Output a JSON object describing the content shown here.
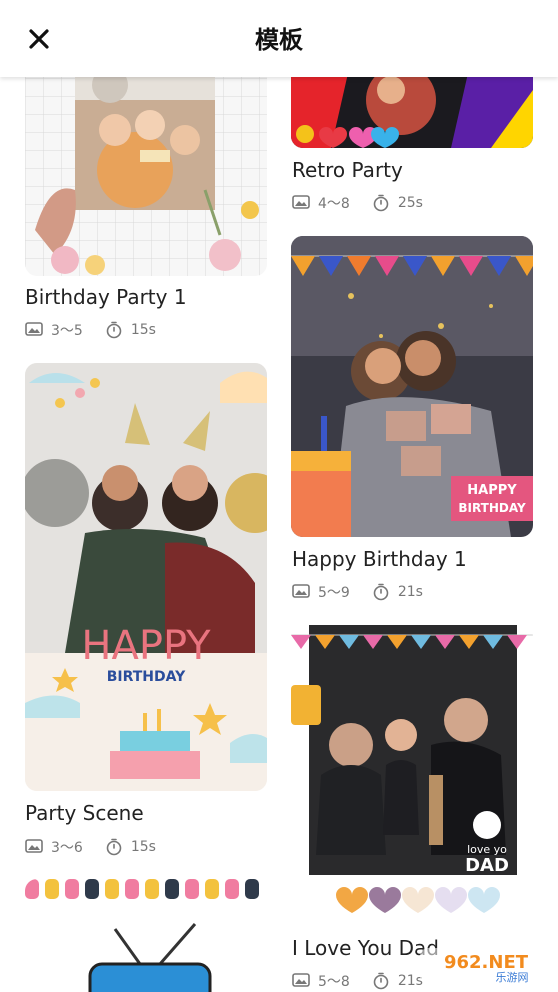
{
  "header": {
    "title": "模板",
    "close_icon": "close-icon"
  },
  "templates": [
    {
      "name": "Birthday Party 1",
      "photos": "3～5",
      "duration": "15s"
    },
    {
      "name": "Retro Party",
      "photos": "4～8",
      "duration": "25s"
    },
    {
      "name": "Party Scene",
      "photos": "3～6",
      "duration": "15s"
    },
    {
      "name": "Happy Birthday 1",
      "photos": "5～9",
      "duration": "21s"
    },
    {
      "name": "I Love You Dad",
      "photos": "5～8",
      "duration": "21s"
    }
  ],
  "card_text": {
    "party_scene_happy": "HAPPY",
    "party_scene_birthday": "BIRTHDAY",
    "hb1_happy": "HAPPY",
    "hb1_birthday": "BIRTHDAY",
    "dad_love": "love yo",
    "dad_dad": "DAD"
  },
  "watermark": {
    "text": "962.NET",
    "sub": "乐游网"
  },
  "colors": {
    "accent": "#ffffff",
    "text": "#222222",
    "meta": "#777777"
  }
}
